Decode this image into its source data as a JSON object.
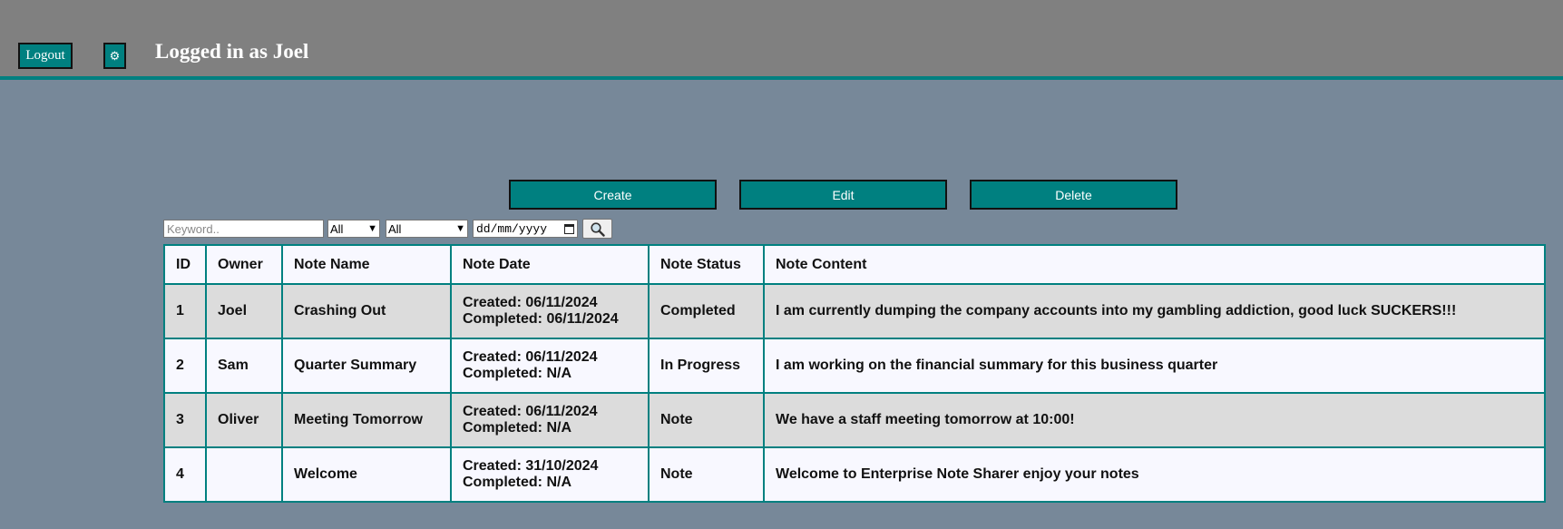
{
  "header": {
    "logout_label": "Logout",
    "settings_icon": "gear-icon",
    "settings_glyph": "⚙",
    "title": "Logged in as Joel",
    "bar_color": "#808080",
    "accent": "#008080"
  },
  "actions": {
    "create_label": "Create",
    "edit_label": "Edit",
    "delete_label": "Delete"
  },
  "filters": {
    "keyword_placeholder": "Keyword..",
    "owner_select": "All",
    "status_select": "All",
    "date_placeholder": "dd/mm/yyyy",
    "search_icon": "search-icon"
  },
  "table": {
    "headers": [
      "ID",
      "Owner",
      "Note Name",
      "Note Date",
      "Note Status",
      "Note Content"
    ],
    "rows": [
      {
        "id": "1",
        "owner": "Joel",
        "name": "Crashing Out",
        "created": "Created: 06/11/2024",
        "completed": "Completed: 06/11/2024",
        "status": "Completed",
        "content": "I am currently dumping the company accounts into my gambling addiction, good luck SUCKERS!!!"
      },
      {
        "id": "2",
        "owner": "Sam",
        "name": "Quarter Summary",
        "created": "Created: 06/11/2024",
        "completed": "Completed: N/A",
        "status": "In Progress",
        "content": "I am working on the financial summary for this business quarter"
      },
      {
        "id": "3",
        "owner": "Oliver",
        "name": "Meeting Tomorrow",
        "created": "Created: 06/11/2024",
        "completed": "Completed: N/A",
        "status": "Note",
        "content": "We have a staff meeting tomorrow at 10:00!"
      },
      {
        "id": "4",
        "owner": "",
        "name": "Welcome",
        "created": "Created: 31/10/2024",
        "completed": "Completed: N/A",
        "status": "Note",
        "content": "Welcome to Enterprise Note Sharer enjoy your notes"
      }
    ]
  }
}
